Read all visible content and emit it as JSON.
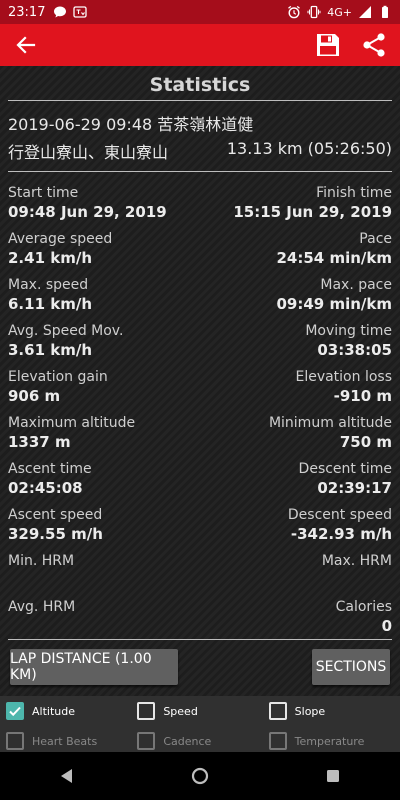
{
  "status_bar": {
    "time": "23:17",
    "network": "4G+"
  },
  "header": {
    "title": "Statistics"
  },
  "track": {
    "datetime_name": "2019-06-29 09:48 苦茶嶺林道健",
    "name_cont": "行登山寮山、東山寮山",
    "distance_duration": "13.13 km (05:26:50)"
  },
  "stats": [
    {
      "left_label": "Start time",
      "left_value": "09:48 Jun 29, 2019",
      "right_label": "Finish time",
      "right_value": "15:15 Jun 29, 2019"
    },
    {
      "left_label": "Average speed",
      "left_value": "2.41 km/h",
      "right_label": "Pace",
      "right_value": "24:54 min/km"
    },
    {
      "left_label": "Max. speed",
      "left_value": "6.11 km/h",
      "right_label": "Max. pace",
      "right_value": "09:49 min/km"
    },
    {
      "left_label": "Avg. Speed Mov.",
      "left_value": "3.61 km/h",
      "right_label": "Moving time",
      "right_value": "03:38:05"
    },
    {
      "left_label": "Elevation gain",
      "left_value": "906 m",
      "right_label": "Elevation loss",
      "right_value": "-910 m"
    },
    {
      "left_label": "Maximum altitude",
      "left_value": "1337 m",
      "right_label": "Minimum altitude",
      "right_value": "750 m"
    },
    {
      "left_label": "Ascent time",
      "left_value": "02:45:08",
      "right_label": "Descent time",
      "right_value": "02:39:17"
    },
    {
      "left_label": "Ascent speed",
      "left_value": "329.55 m/h",
      "right_label": "Descent speed",
      "right_value": "-342.93 m/h"
    },
    {
      "left_label": "Min. HRM",
      "left_value": "",
      "right_label": "Max. HRM",
      "right_value": ""
    },
    {
      "left_label": "Avg. HRM",
      "left_value": "",
      "right_label": "Calories",
      "right_value": "0"
    }
  ],
  "buttons": {
    "lap": "LAP DISTANCE (1.00  KM)",
    "sections": "SECTIONS"
  },
  "filters": {
    "row1": [
      {
        "label": "Altitude",
        "checked": true
      },
      {
        "label": "Speed",
        "checked": false
      },
      {
        "label": "Slope",
        "checked": false
      }
    ],
    "row2": [
      {
        "label": "Heart Beats",
        "checked": false
      },
      {
        "label": "Cadence",
        "checked": false
      },
      {
        "label": "Temperature",
        "checked": false
      }
    ]
  },
  "colors": {
    "status_bar": "#a50d1b",
    "app_bar": "#e0141e",
    "check_accent": "#4db6ac"
  }
}
